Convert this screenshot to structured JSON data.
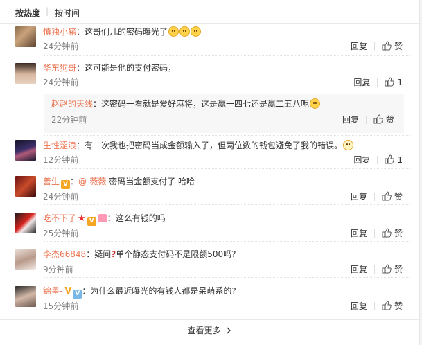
{
  "sort": {
    "hot": "按热度",
    "sep": "|",
    "time": "按时间"
  },
  "actions": {
    "reply": "回复",
    "like": "赞"
  },
  "comments": [
    {
      "user": "慎独小猪",
      "text": "这哥们儿的密码曝光了",
      "time": "24分钟前",
      "like": "赞"
    },
    {
      "user": "华东狗哥",
      "text": "这可能是他的支付密码，",
      "time": "24分钟前",
      "like": "1"
    },
    {
      "user": "赵赵的天线",
      "text": "这密码一看就是爱好麻将，这是赢一四七还是赢二五八呢",
      "time": "22分钟前",
      "like": "赞"
    },
    {
      "user": "生性涩浪",
      "text": "有一次我也把密码当成金额输入了，但两位数的钱包避免了我的错误。",
      "time": "12分钟前",
      "like": "1"
    },
    {
      "user": "善生",
      "mention": "@-薇薇",
      "text": "密码当金额支付了 哈哈",
      "time": "24分钟前",
      "like": "赞"
    },
    {
      "user": "吃不下了",
      "text": "这么有钱的吗",
      "time": "25分钟前",
      "like": "赞"
    },
    {
      "user": "李杰66848",
      "text_a": "疑问",
      "text_b": "单个静态支付码不是限额500吗?",
      "time": "9分钟前",
      "like": "赞"
    },
    {
      "user": "锦墨-",
      "text": "为什么最近曝光的有钱人都是呆萌系的?",
      "time": "15分钟前",
      "like": "赞"
    }
  ],
  "more": "查看更多",
  "more_icon": "chevron-right-icon",
  "colors": {
    "username": "#eb7350",
    "time": "#808080"
  }
}
